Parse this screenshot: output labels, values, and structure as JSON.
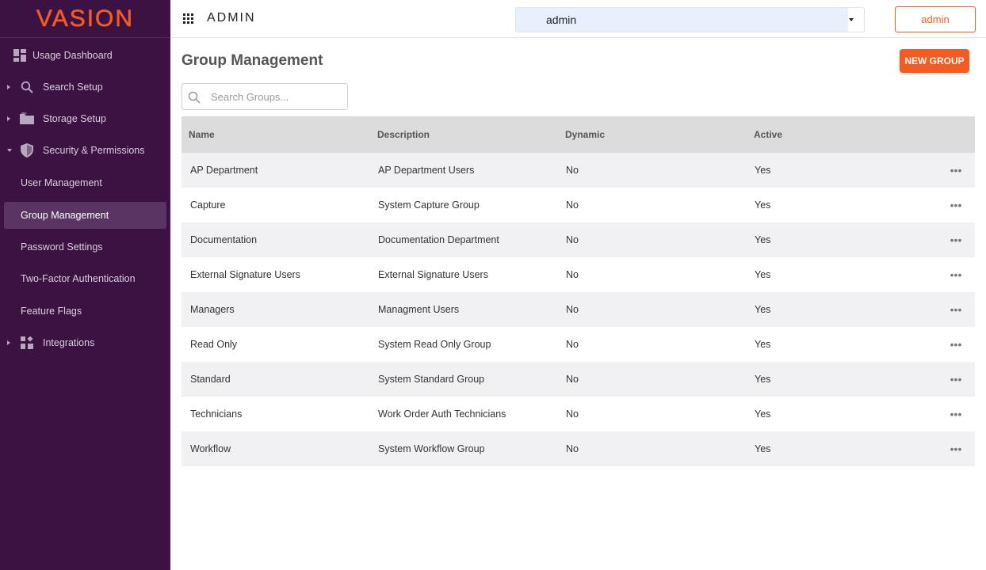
{
  "app": {
    "logo_text": "VASION",
    "section_title": "ADMIN",
    "brand_color": "#f25c22",
    "sidebar_color": "#3c1243"
  },
  "topbar": {
    "vault_select_value": "admin",
    "user_button_label": "admin"
  },
  "sidebar": {
    "items": [
      {
        "label": "Usage Dashboard",
        "icon": "dashboard-icon",
        "expandable": false
      },
      {
        "label": "Search Setup",
        "icon": "search-icon",
        "expandable": true
      },
      {
        "label": "Storage Setup",
        "icon": "folder-icon",
        "expandable": true
      },
      {
        "label": "Security & Permissions",
        "icon": "shield-icon",
        "expandable": true,
        "expanded": true
      },
      {
        "label": "User Management",
        "sub": true
      },
      {
        "label": "Group Management",
        "sub": true,
        "active": true
      },
      {
        "label": "Password Settings",
        "sub": true
      },
      {
        "label": "Two-Factor Authentication",
        "sub": true
      },
      {
        "label": "Feature Flags",
        "sub": true
      },
      {
        "label": "Integrations",
        "icon": "integrations-icon",
        "expandable": true
      }
    ]
  },
  "main": {
    "title": "Group Management",
    "new_button_label": "NEW GROUP",
    "search_placeholder": "Search Groups...",
    "table": {
      "headers": [
        "Name",
        "Description",
        "Dynamic",
        "Active"
      ],
      "rows": [
        {
          "name": "AP Department",
          "description": "AP Department Users",
          "dynamic": "No",
          "active": "Yes"
        },
        {
          "name": "Capture",
          "description": "System Capture Group",
          "dynamic": "No",
          "active": "Yes"
        },
        {
          "name": "Documentation",
          "description": "Documentation Department",
          "dynamic": "No",
          "active": "Yes"
        },
        {
          "name": "External Signature Users",
          "description": "External Signature Users",
          "dynamic": "No",
          "active": "Yes"
        },
        {
          "name": "Managers",
          "description": "Managment Users",
          "dynamic": "No",
          "active": "Yes"
        },
        {
          "name": "Read Only",
          "description": "System Read Only Group",
          "dynamic": "No",
          "active": "Yes"
        },
        {
          "name": "Standard",
          "description": "System Standard Group",
          "dynamic": "No",
          "active": "Yes"
        },
        {
          "name": "Technicians",
          "description": "Work Order Auth Technicians",
          "dynamic": "No",
          "active": "Yes"
        },
        {
          "name": "Workflow",
          "description": "System Workflow Group",
          "dynamic": "No",
          "active": "Yes"
        }
      ],
      "row_menu_glyph": "•••"
    }
  }
}
